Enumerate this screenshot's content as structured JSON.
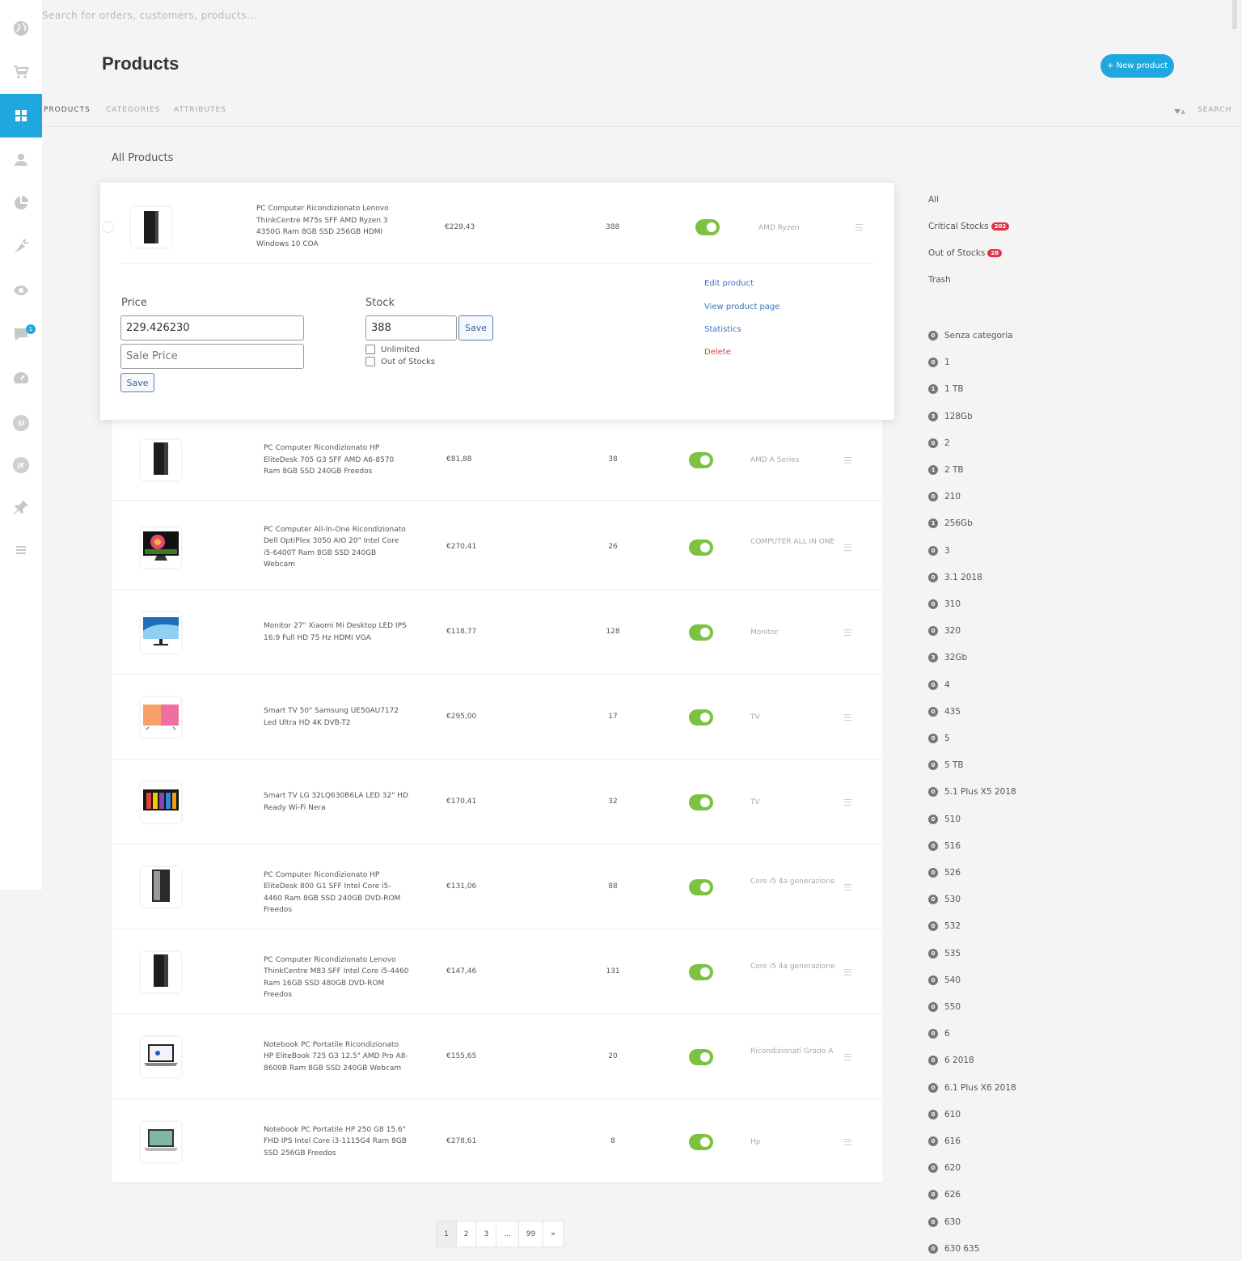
{
  "search": {
    "placeholder": "Search for orders, customers, products..."
  },
  "header": {
    "title": "Products",
    "new_button": "+ New product"
  },
  "tabs": [
    {
      "label": "PRODUCTS",
      "active": true
    },
    {
      "label": "CATEGORIES",
      "active": false
    },
    {
      "label": "ATTRIBUTES",
      "active": false
    }
  ],
  "tab_search": "SEARCH",
  "section_title": "All Products",
  "sidebar": {
    "icons": [
      "globe-icon",
      "cart-icon",
      "grid-icon",
      "user-icon",
      "pie-chart-icon",
      "carrot-icon",
      "eye-icon",
      "chat-icon",
      "dashboard-icon",
      "avatar-si",
      "avatar-je",
      "pin-icon",
      "menu-icon"
    ],
    "chat_badge": "1",
    "avatar_si": "SI",
    "avatar_je": "JE",
    "accent_color": "#1fa8e0"
  },
  "expanded": {
    "name": "PC Computer Ricondizionato Lenovo ThinkCentre M75s SFF AMD Ryzen 3 4350G Ram 8GB SSD 256GB HDMI Windows 10 COA",
    "price": "€229,43",
    "stock": "388",
    "category": "AMD Ryzen",
    "price_label": "Price",
    "price_value": "229.426230",
    "sale_price_placeholder": "Sale Price",
    "stock_label": "Stock",
    "stock_value": "388",
    "save_label": "Save",
    "unlimited_label": "Unlimited",
    "out_of_stocks_label": "Out of Stocks",
    "actions": {
      "edit": "Edit product",
      "view": "View product page",
      "stats": "Statistics",
      "delete": "Delete"
    }
  },
  "products": [
    {
      "name": "PC Computer Ricondizionato HP EliteDesk 705 G3 SFF AMD A6-8570 Ram 8GB SSD 240GB Freedos",
      "price": "€81,88",
      "stock": "38",
      "category": "AMD A Series",
      "thumb": "tower"
    },
    {
      "name": "PC Computer All-In-One Ricondizionato Dell OptiPlex 3050 AIO 20\" Intel Core i5-6400T Ram 8GB SSD 240GB Webcam",
      "price": "€270,41",
      "stock": "26",
      "category": "COMPUTER ALL IN ONE",
      "thumb": "aio"
    },
    {
      "name": "Monitor 27\" Xiaomi Mi Desktop LED IPS 16:9 Full HD 75 Hz HDMI VGA",
      "price": "€118,77",
      "stock": "128",
      "category": "Monitor",
      "thumb": "monitor"
    },
    {
      "name": "Smart TV 50\" Samsung UE50AU7172 Led Ultra HD 4K DVB-T2",
      "price": "€295,00",
      "stock": "17",
      "category": "TV",
      "thumb": "tv1"
    },
    {
      "name": "Smart TV LG 32LQ630B6LA LED 32\" HD Ready Wi-Fi Nera",
      "price": "€170,41",
      "stock": "32",
      "category": "TV",
      "thumb": "tv2"
    },
    {
      "name": "PC Computer Ricondizionato HP EliteDesk 800 G1 SFF Intel Core i5-4460 Ram 8GB SSD 240GB DVD-ROM Freedos",
      "price": "€131,06",
      "stock": "88",
      "category": "Core i5 4a generazione",
      "thumb": "tower2"
    },
    {
      "name": "PC Computer Ricondizionato Lenovo ThinkCentre M83 SFF Intel Core i5-4460 Ram 16GB SSD 480GB DVD-ROM Freedos",
      "price": "€147,46",
      "stock": "131",
      "category": "Core i5 4a generazione",
      "thumb": "tower"
    },
    {
      "name": "Notebook PC Portatile Ricondizionato HP EliteBook 725 G3 12.5\" AMD Pro A8-8600B Ram 8GB SSD 240GB Webcam",
      "price": "€155,65",
      "stock": "20",
      "category": "Ricondizionati Grado A",
      "thumb": "laptop"
    },
    {
      "name": "Notebook PC Portatile HP 250 G8 15.6\" FHD IPS Intel Core i3-1115G4 Ram 8GB SSD 256GB Freedos",
      "price": "€278,61",
      "stock": "8",
      "category": "Hp",
      "thumb": "laptop2"
    }
  ],
  "filters": [
    {
      "label": "All",
      "badge": ""
    },
    {
      "label": "Critical Stocks",
      "badge": "202"
    },
    {
      "label": "Out of Stocks",
      "badge": "28"
    },
    {
      "label": "Trash",
      "badge": ""
    }
  ],
  "categories": [
    {
      "label": "Senza categoria",
      "count": "0"
    },
    {
      "label": "1",
      "count": "0"
    },
    {
      "label": "1 TB",
      "count": "1"
    },
    {
      "label": "128Gb",
      "count": "3"
    },
    {
      "label": "2",
      "count": "0"
    },
    {
      "label": "2 TB",
      "count": "1"
    },
    {
      "label": "210",
      "count": "0"
    },
    {
      "label": "256Gb",
      "count": "1"
    },
    {
      "label": "3",
      "count": "0"
    },
    {
      "label": "3.1 2018",
      "count": "0"
    },
    {
      "label": "310",
      "count": "0"
    },
    {
      "label": "320",
      "count": "0"
    },
    {
      "label": "32Gb",
      "count": "3"
    },
    {
      "label": "4",
      "count": "0"
    },
    {
      "label": "435",
      "count": "0"
    },
    {
      "label": "5",
      "count": "0"
    },
    {
      "label": "5 TB",
      "count": "0"
    },
    {
      "label": "5.1 Plus X5 2018",
      "count": "0"
    },
    {
      "label": "510",
      "count": "0"
    },
    {
      "label": "516",
      "count": "0"
    },
    {
      "label": "526",
      "count": "0"
    },
    {
      "label": "530",
      "count": "0"
    },
    {
      "label": "532",
      "count": "0"
    },
    {
      "label": "535",
      "count": "0"
    },
    {
      "label": "540",
      "count": "0"
    },
    {
      "label": "550",
      "count": "0"
    },
    {
      "label": "6",
      "count": "0"
    },
    {
      "label": "6 2018",
      "count": "0"
    },
    {
      "label": "6.1 Plus X6 2018",
      "count": "0"
    },
    {
      "label": "610",
      "count": "0"
    },
    {
      "label": "616",
      "count": "0"
    },
    {
      "label": "620",
      "count": "0"
    },
    {
      "label": "626",
      "count": "0"
    },
    {
      "label": "630",
      "count": "0"
    },
    {
      "label": "630 635",
      "count": "0"
    }
  ],
  "pagination": [
    "1",
    "2",
    "3",
    "...",
    "99",
    "»"
  ],
  "toggle_color": "#7cc240"
}
